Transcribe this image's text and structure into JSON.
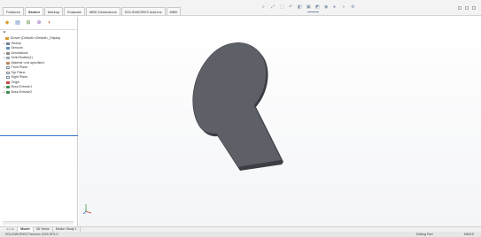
{
  "command_tabs": [
    "Features",
    "Sketch",
    "Markup",
    "Evaluate",
    "MBD Dimensions",
    "SOLIDWORKS Add-Ins",
    "MBD"
  ],
  "active_command_tab": "Sketch",
  "hud_icons": [
    "search-icon",
    "zoom-fit-icon",
    "zoom-area-icon",
    "previous-view-icon",
    "section-view-icon",
    "view-orientation-icon",
    "display-style-icon",
    "hide-show-icon",
    "appearance-icon",
    "scene-icon",
    "view-settings-icon"
  ],
  "panel": {
    "tab_icons": [
      "feature-manager-icon",
      "property-manager-icon",
      "configuration-manager-icon",
      "dimxpert-icon",
      "display-manager-icon"
    ],
    "tree": [
      {
        "label": "Grovex  (Default<<Default>_Display",
        "icon": "part-icon",
        "expand": ""
      },
      {
        "label": "History",
        "icon": "history-icon",
        "expand": "▸"
      },
      {
        "label": "Sensors",
        "icon": "sensors-icon",
        "expand": ""
      },
      {
        "label": "Annotations",
        "icon": "annotations-icon",
        "expand": "▸"
      },
      {
        "label": "Solid Bodies(1)",
        "icon": "solid-bodies-icon",
        "expand": "▸"
      },
      {
        "label": "Material <not specified>",
        "icon": "material-icon",
        "expand": ""
      },
      {
        "label": "Front Plane",
        "icon": "plane-icon",
        "expand": ""
      },
      {
        "label": "Top Plane",
        "icon": "plane-icon",
        "expand": ""
      },
      {
        "label": "Right Plane",
        "icon": "plane-icon",
        "expand": ""
      },
      {
        "label": "Origin",
        "icon": "origin-icon",
        "expand": ""
      },
      {
        "label": "Boss-Extrude1",
        "icon": "boss-extrude-icon",
        "expand": "▸"
      },
      {
        "label": "Boss-Extrude2",
        "icon": "boss-extrude-icon",
        "expand": "▸"
      }
    ]
  },
  "bottom_tabs": [
    "Model",
    "3D Views",
    "Motion Study 1"
  ],
  "active_bottom_tab": "Model",
  "status": {
    "left": "SOLIDWORKS Premium 2020 SP4.0",
    "mid": "Editing Part",
    "right": "MMGS"
  },
  "colors": {
    "part_face": "#5d6066",
    "part_edge": "#3c3e44",
    "accent": "#2f76c4"
  }
}
